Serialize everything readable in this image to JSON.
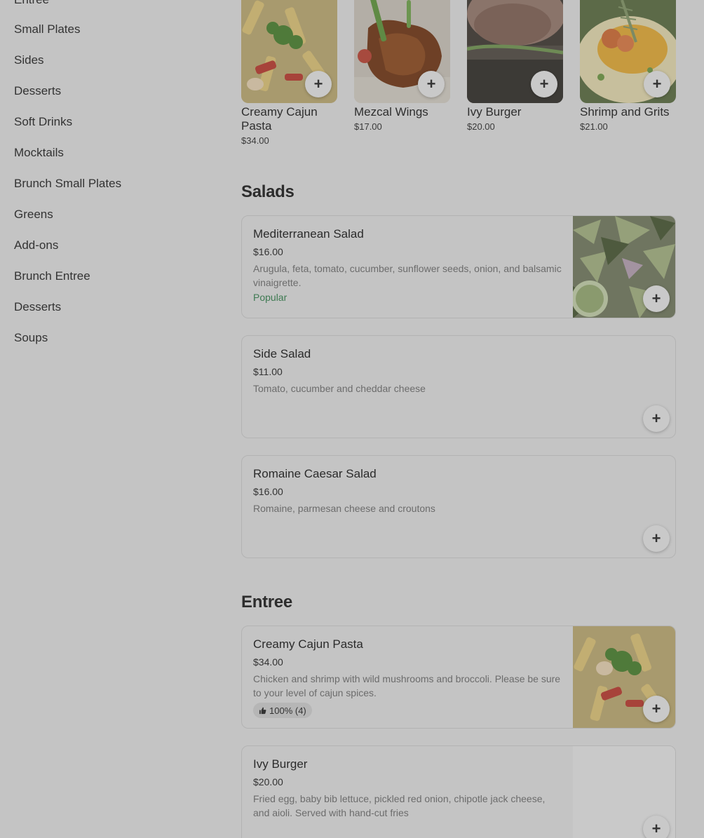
{
  "sidebar": {
    "items": [
      {
        "label": "Entree"
      },
      {
        "label": "Small Plates"
      },
      {
        "label": "Sides"
      },
      {
        "label": "Desserts"
      },
      {
        "label": "Soft Drinks"
      },
      {
        "label": "Mocktails"
      },
      {
        "label": "Brunch Small Plates"
      },
      {
        "label": "Greens"
      },
      {
        "label": "Add-ons"
      },
      {
        "label": "Brunch Entree"
      },
      {
        "label": "Desserts"
      },
      {
        "label": "Soups"
      }
    ]
  },
  "featured": [
    {
      "name": "Creamy Cajun Pasta",
      "price": "$34.00"
    },
    {
      "name": "Mezcal Wings",
      "price": "$17.00"
    },
    {
      "name": "Ivy Burger",
      "price": "$20.00"
    },
    {
      "name": "Shrimp and Grits",
      "price": "$21.00"
    }
  ],
  "add_icon": "plus-icon",
  "sections": {
    "salads": {
      "title": "Salads",
      "items": [
        {
          "name": "Mediterranean Salad",
          "price": "$16.00",
          "description": "Arugula, feta, tomato, cucumber, sunflower seeds, onion, and balsamic vinaigrette.",
          "badge": "Popular"
        },
        {
          "name": "Side Salad",
          "price": "$11.00",
          "description": "Tomato, cucumber and cheddar cheese"
        },
        {
          "name": "Romaine Caesar Salad",
          "price": "$16.00",
          "description": "Romaine, parmesan cheese and croutons"
        }
      ]
    },
    "entree": {
      "title": "Entree",
      "items": [
        {
          "name": "Creamy Cajun Pasta",
          "price": "$34.00",
          "description": "Chicken and shrimp with wild mushrooms and broccoli. Please be sure to your level of cajun spices.",
          "rating": "100% (4)"
        },
        {
          "name": "Ivy Burger",
          "price": "$20.00",
          "description": "Fried egg, baby bib lettuce, pickled red onion, chipotle jack cheese, and aioli. Served with hand-cut fries"
        }
      ]
    }
  },
  "colors": {
    "overlay": "#c4c4c4",
    "popular": "#3e7a52"
  }
}
